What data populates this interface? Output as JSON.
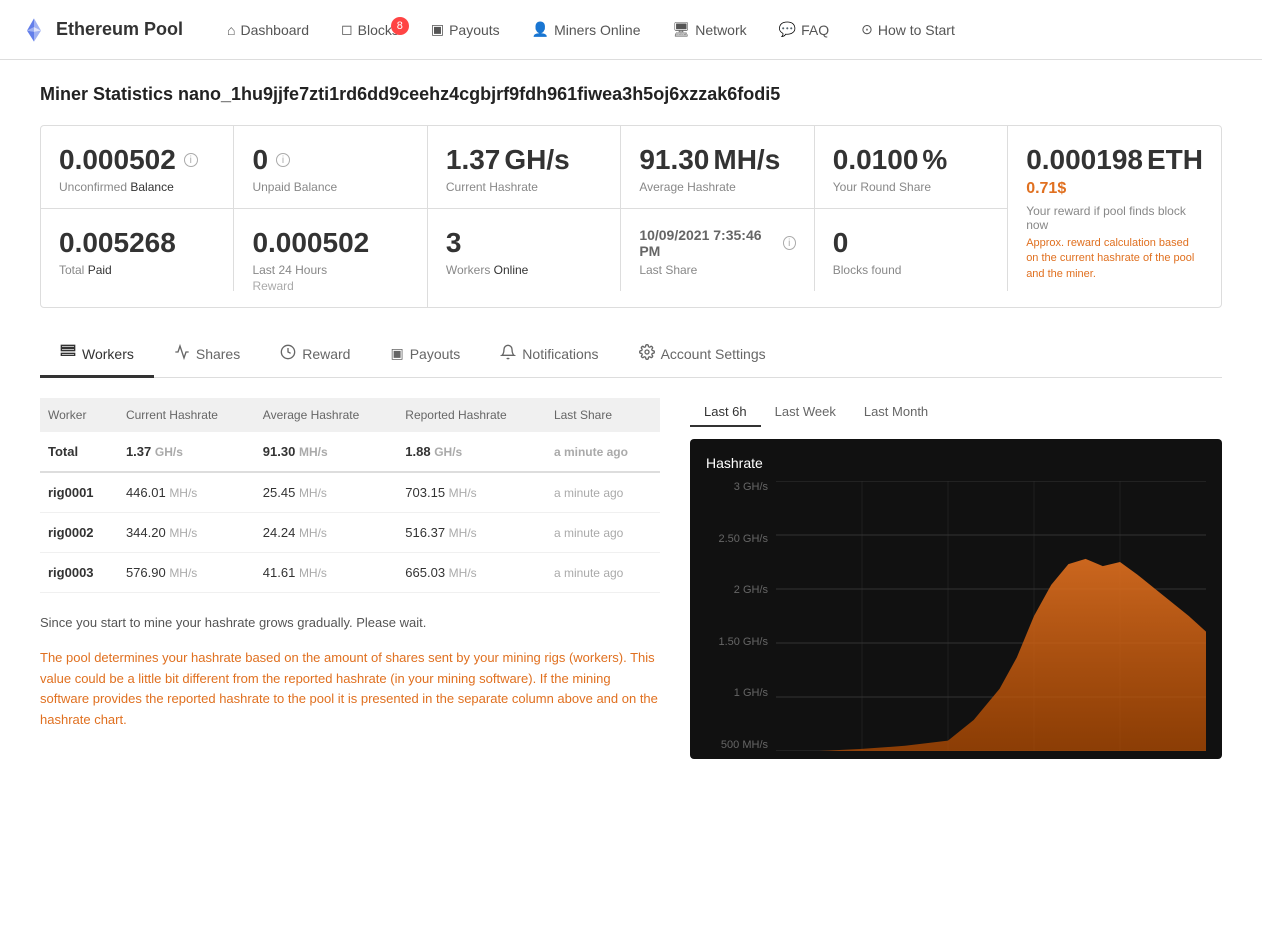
{
  "brand": {
    "name": "Ethereum Pool"
  },
  "nav": {
    "items": [
      {
        "label": "Dashboard",
        "icon": "home-icon",
        "badge": null
      },
      {
        "label": "Blocks",
        "icon": "box-icon",
        "badge": "8"
      },
      {
        "label": "Payouts",
        "icon": "payout-icon",
        "badge": null
      },
      {
        "label": "Miners Online",
        "icon": "miners-icon",
        "badge": null
      },
      {
        "label": "Network",
        "icon": "network-icon",
        "badge": null
      },
      {
        "label": "FAQ",
        "icon": "faq-icon",
        "badge": null
      },
      {
        "label": "How to Start",
        "icon": "help-icon",
        "badge": null
      }
    ]
  },
  "page": {
    "title": "Miner Statistics nano_1hu9jjfe7zti1rd6dd9ceehz4cgbjrf9fdh961fiwea3h5oj6xzzak6fodi5"
  },
  "stats": {
    "unconfirmed_value": "0.000502",
    "unconfirmed_label": "Unconfirmed",
    "unconfirmed_sublabel": "Balance",
    "unpaid_value": "0",
    "unpaid_label": "Unpaid Balance",
    "hashrate_current_value": "1.37",
    "hashrate_current_unit": "GH/s",
    "hashrate_current_label": "Current Hashrate",
    "hashrate_avg_value": "91.30",
    "hashrate_avg_unit": "MH/s",
    "hashrate_avg_label": "Average Hashrate",
    "round_share_value": "0.0100",
    "round_share_unit": "%",
    "round_share_label": "Your Round Share",
    "reward_eth_value": "0.000198",
    "reward_eth_unit": "ETH",
    "reward_usd": "0.71$",
    "reward_label": "Your reward if pool finds block now",
    "approx_text": "Approx. reward calculation based on the current hashrate of the pool and the miner.",
    "total_paid_value": "0.005268",
    "total_paid_label": "Total",
    "total_paid_sublabel": "Paid",
    "last24_value": "0.000502",
    "last24_label": "Last 24 Hours",
    "last24_sublabel": "Reward",
    "workers_online_value": "3",
    "workers_online_label": "Workers",
    "workers_online_sublabel": "Online",
    "last_share_value": "10/09/2021 7:35:46 PM",
    "last_share_label": "Last Share",
    "blocks_found_value": "0",
    "blocks_found_label": "Blocks found"
  },
  "tabs": [
    {
      "label": "Workers",
      "icon": "layers-icon",
      "active": true
    },
    {
      "label": "Shares",
      "icon": "chart-icon",
      "active": false
    },
    {
      "label": "Reward",
      "icon": "reward-icon",
      "active": false
    },
    {
      "label": "Payouts",
      "icon": "payout-tab-icon",
      "active": false
    },
    {
      "label": "Notifications",
      "icon": "bell-icon",
      "active": false
    },
    {
      "label": "Account Settings",
      "icon": "settings-icon",
      "active": false
    }
  ],
  "table": {
    "headers": [
      "Worker",
      "Current Hashrate",
      "Average Hashrate",
      "Reported Hashrate",
      "Last Share"
    ],
    "rows": [
      {
        "worker": "Total",
        "current": "1.37",
        "current_unit": "GH/s",
        "avg": "91.30",
        "avg_unit": "MH/s",
        "reported": "1.88",
        "reported_unit": "GH/s",
        "last_share": "a minute ago",
        "is_total": true
      },
      {
        "worker": "rig0001",
        "current": "446.01",
        "current_unit": "MH/s",
        "avg": "25.45",
        "avg_unit": "MH/s",
        "reported": "703.15",
        "reported_unit": "MH/s",
        "last_share": "a minute ago",
        "is_total": false
      },
      {
        "worker": "rig0002",
        "current": "344.20",
        "current_unit": "MH/s",
        "avg": "24.24",
        "avg_unit": "MH/s",
        "reported": "516.37",
        "reported_unit": "MH/s",
        "last_share": "a minute ago",
        "is_total": false
      },
      {
        "worker": "rig0003",
        "current": "576.90",
        "current_unit": "MH/s",
        "avg": "41.61",
        "avg_unit": "MH/s",
        "reported": "665.03",
        "reported_unit": "MH/s",
        "last_share": "a minute ago",
        "is_total": false
      }
    ]
  },
  "info_text": "Since you start to mine your hashrate grows gradually. Please wait.",
  "info_text_orange": "The pool determines your hashrate based on the amount of shares sent by your mining rigs (workers). This value could be a little bit different from the reported hashrate (in your mining software). If the mining software provides the reported hashrate to the pool it is presented in the separate column above and on the hashrate chart.",
  "chart": {
    "title": "Hashrate",
    "tabs": [
      "Last 6h",
      "Last Week",
      "Last Month"
    ],
    "active_tab": "Last 6h",
    "y_labels": [
      "3 GH/s",
      "2.50 GH/s",
      "2 GH/s",
      "1.50 GH/s",
      "1 GH/s",
      "500 MH/s"
    ]
  }
}
